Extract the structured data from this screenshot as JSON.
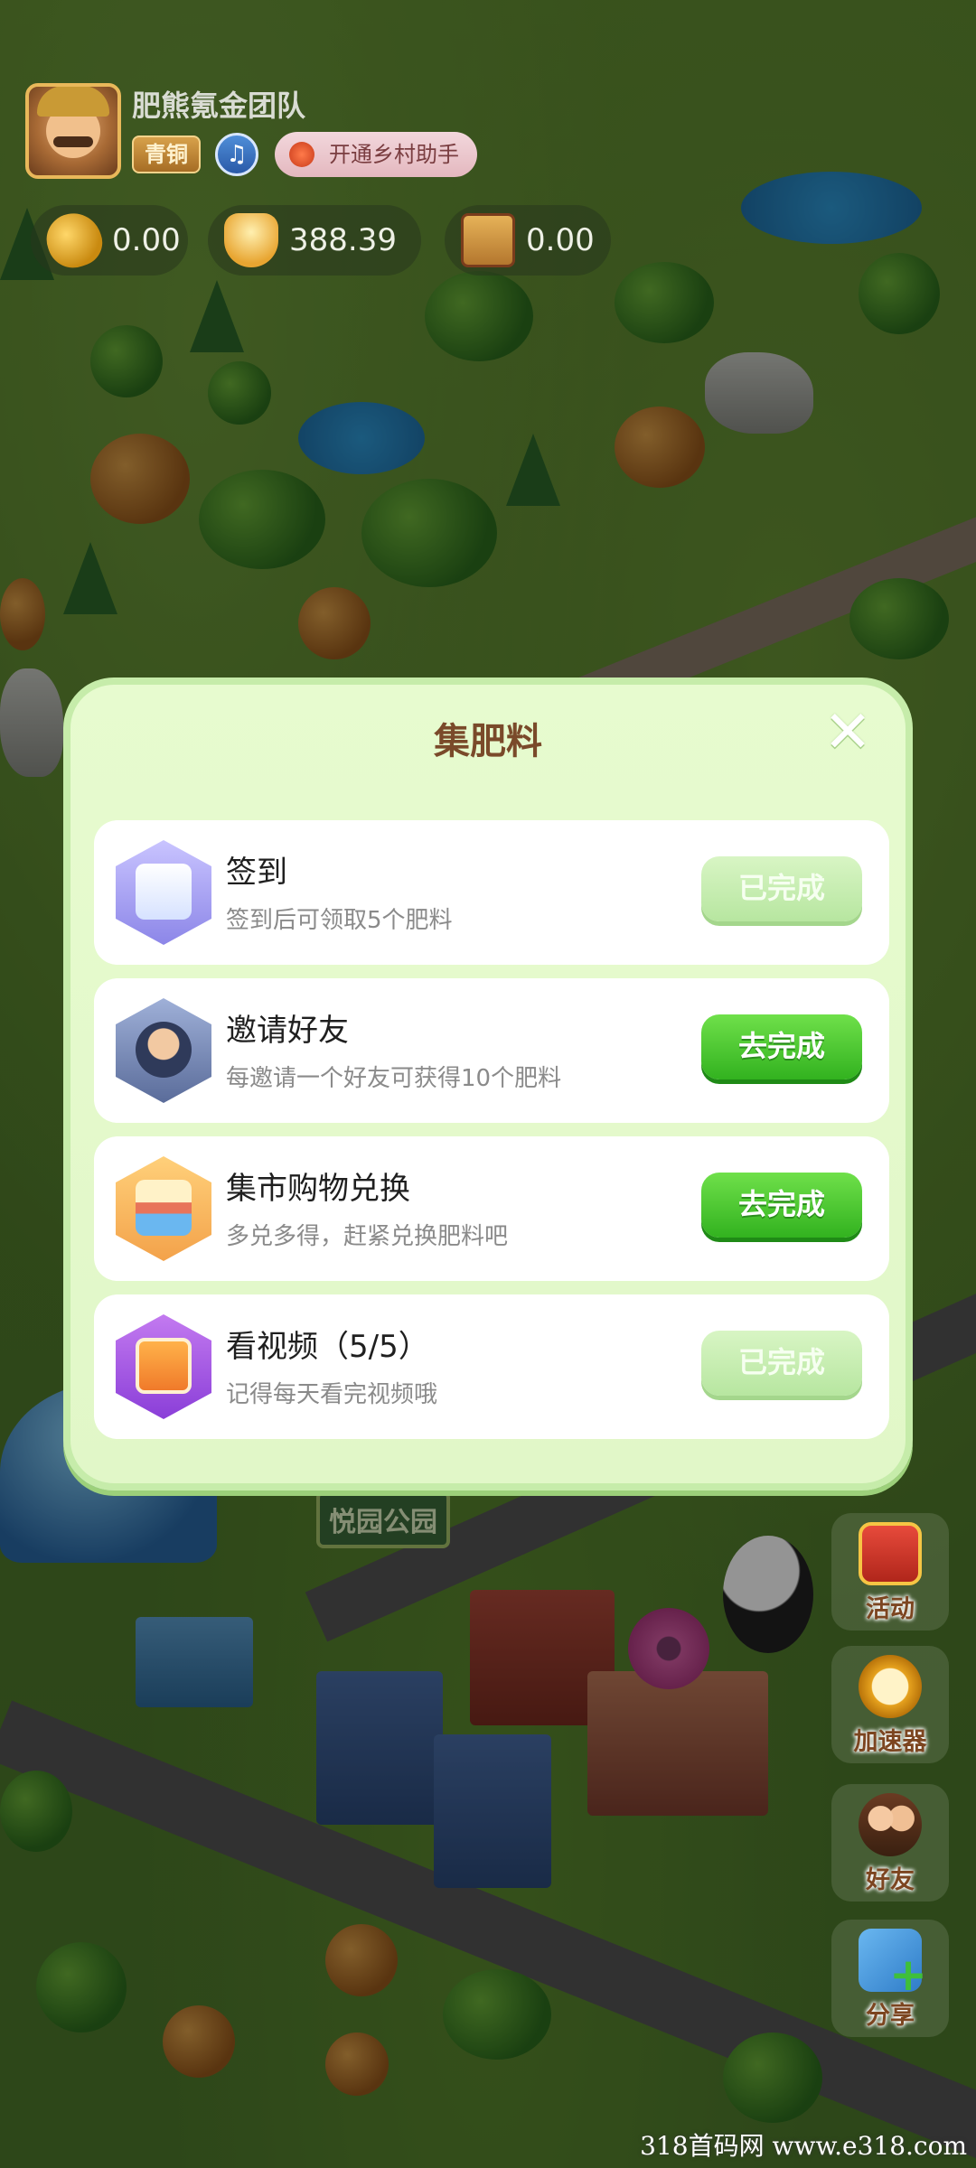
{
  "header": {
    "team_name": "肥熊氪金团队",
    "rank_badge": "青铜",
    "helper_button": "开通乡村助手",
    "music_icon": "♫"
  },
  "resources": [
    {
      "name": "bean-icon",
      "value": "0.00"
    },
    {
      "name": "gold-ingot-icon",
      "value": "388.39"
    },
    {
      "name": "fertilizer-bag-icon",
      "value": "0.00"
    }
  ],
  "map": {
    "park_sign": "悦园公园"
  },
  "side_buttons": [
    {
      "label": "活动",
      "icon": "gift-icon"
    },
    {
      "label": "加速器",
      "icon": "alarm-clock-icon"
    },
    {
      "label": "好友",
      "icon": "friends-icon"
    },
    {
      "label": "分享",
      "icon": "share-icon"
    }
  ],
  "modal": {
    "title": "集肥料",
    "close_icon": "✕",
    "tasks": [
      {
        "title": "签到",
        "desc": "签到后可领取5个肥料",
        "button": "已完成",
        "status": "done",
        "icon": "calendar-icon"
      },
      {
        "title": "邀请好友",
        "desc": "每邀请一个好友可获得10个肥料",
        "button": "去完成",
        "status": "todo",
        "icon": "avatar-icon"
      },
      {
        "title": "集市购物兑换",
        "desc": "多兑多得，赶紧兑换肥料吧",
        "button": "去完成",
        "status": "todo",
        "icon": "shop-icon"
      },
      {
        "title": "看视频（5/5）",
        "desc": "记得每天看完视频哦",
        "button": "已完成",
        "status": "done",
        "icon": "tv-icon"
      }
    ]
  },
  "watermark": "318首码网  www.e318.com",
  "colors": {
    "modal_bg": "#e7fbcf",
    "button_green": "#32b21f",
    "button_done": "#b7e6a0",
    "title_brown": "#7a4a2a"
  }
}
